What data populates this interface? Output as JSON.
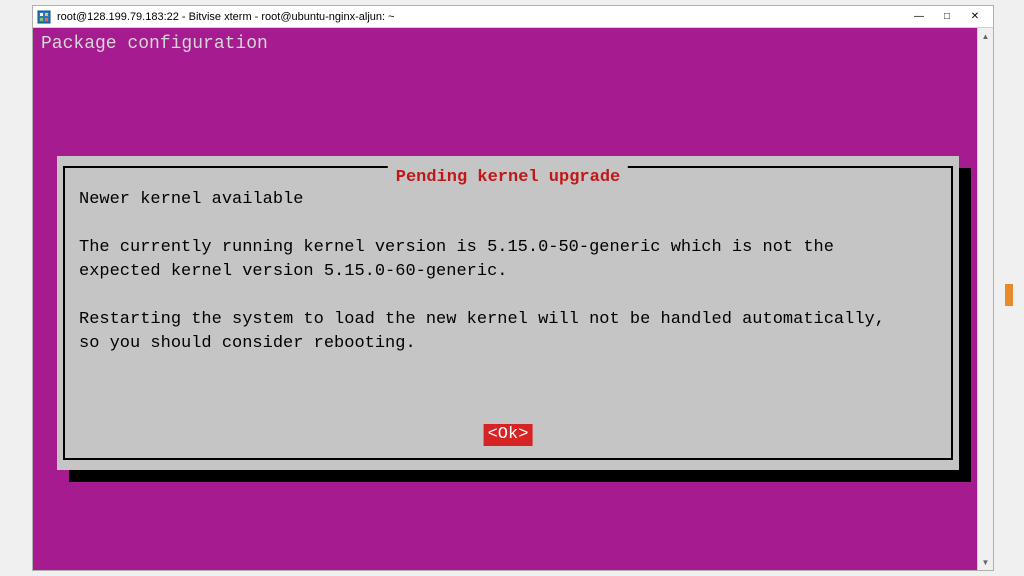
{
  "window": {
    "title": "root@128.199.79.183:22 - Bitvise xterm - root@ubuntu-nginx-aljun: ~",
    "controls": {
      "minimize": "—",
      "maximize": "□",
      "close": "✕"
    }
  },
  "terminal": {
    "header_text": "Package configuration",
    "background_color": "#a61b8f"
  },
  "dialog": {
    "title": "Pending kernel upgrade",
    "subtitle": "Newer kernel available",
    "line1": "The currently running kernel version is 5.15.0-50-generic which is not the",
    "line2": "expected kernel version 5.15.0-60-generic.",
    "line3": "Restarting the system to load the new kernel will not be handled automatically,",
    "line4": "so you should consider rebooting.",
    "ok_label": "<Ok>",
    "title_color": "#c01818",
    "ok_bg": "#d62323",
    "ok_fg": "#ffffff"
  }
}
